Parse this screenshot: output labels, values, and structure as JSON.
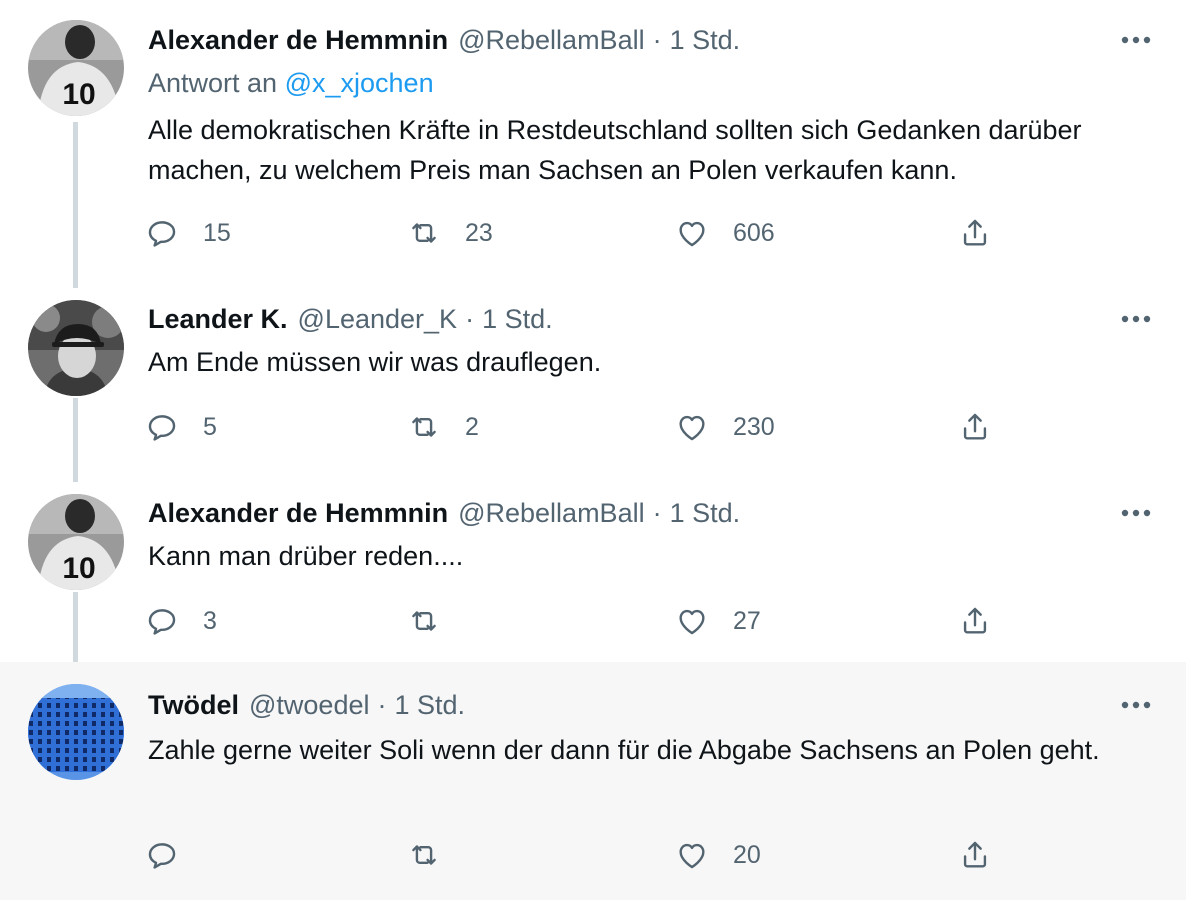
{
  "tweets": [
    {
      "name": "Alexander de Hemmnin",
      "handle": "@RebellamBall",
      "separator": "·",
      "time": "1 Std.",
      "reply_label": "Antwort an",
      "reply_mention": "@x_xjochen",
      "text": "Alle demokratischen Kräfte in Restdeutschland sollten sich Gedanken darüber machen, zu welchem Preis man Sachsen an Polen verkaufen kann.",
      "replies": "15",
      "retweets": "23",
      "likes": "606",
      "avatar_jersey_number": "10"
    },
    {
      "name": "Leander K.",
      "handle": "@Leander_K",
      "separator": "·",
      "time": "1 Std.",
      "text": "Am Ende müssen wir was drauflegen.",
      "replies": "5",
      "retweets": "2",
      "likes": "230"
    },
    {
      "name": "Alexander de Hemmnin",
      "handle": "@RebellamBall",
      "separator": "·",
      "time": "1 Std.",
      "text": "Kann man drüber reden....",
      "replies": "3",
      "retweets": "",
      "likes": "27",
      "avatar_jersey_number": "10"
    },
    {
      "name": "Twödel",
      "handle": "@twoedel",
      "separator": "·",
      "time": "1 Std.",
      "text": "Zahle gerne weiter Soli wenn der dann für die Abgabe Sachsens an Polen geht.",
      "replies": "",
      "retweets": "",
      "likes": "20"
    }
  ],
  "icons": {
    "more": "more-horizontal-icon",
    "reply": "reply-icon",
    "retweet": "retweet-icon",
    "like": "heart-icon",
    "share": "share-icon"
  },
  "colors": {
    "text": "#0f1419",
    "secondary": "#536471",
    "mention": "#1d9bf0",
    "thread_line": "#cfd9de",
    "highlight_bg": "#f7f7f7"
  }
}
